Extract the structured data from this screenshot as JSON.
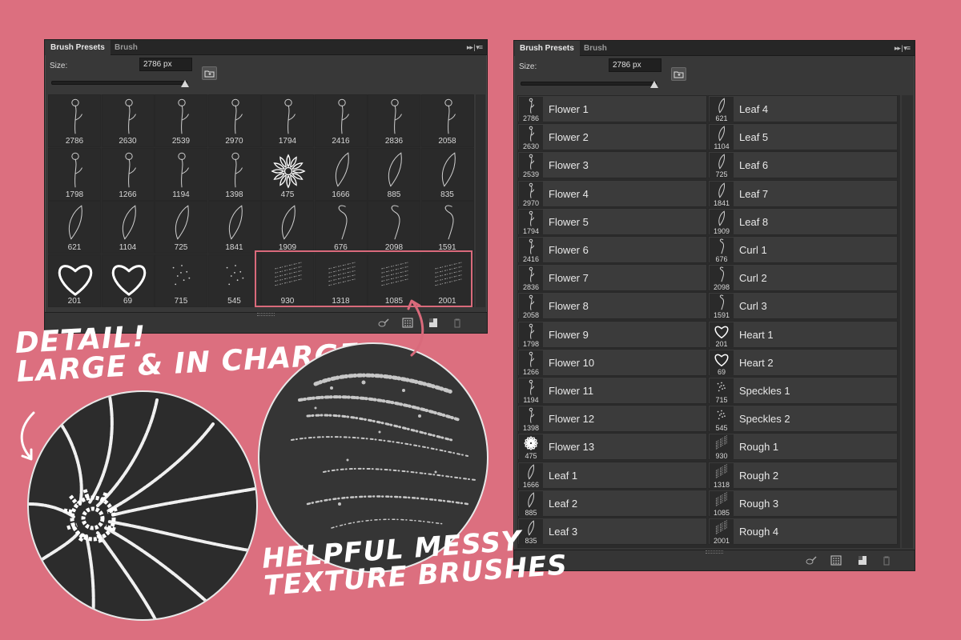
{
  "tabs": {
    "presets": "Brush Presets",
    "brush": "Brush"
  },
  "size": {
    "label": "Size:",
    "value": "2786 px"
  },
  "brushes": [
    {
      "name": "Flower 1",
      "size": "2786"
    },
    {
      "name": "Flower 2",
      "size": "2630"
    },
    {
      "name": "Flower 3",
      "size": "2539"
    },
    {
      "name": "Flower 4",
      "size": "2970"
    },
    {
      "name": "Flower 5",
      "size": "1794"
    },
    {
      "name": "Flower 6",
      "size": "2416"
    },
    {
      "name": "Flower 7",
      "size": "2836"
    },
    {
      "name": "Flower 8",
      "size": "2058"
    },
    {
      "name": "Flower 9",
      "size": "1798"
    },
    {
      "name": "Flower 10",
      "size": "1266"
    },
    {
      "name": "Flower 11",
      "size": "1194"
    },
    {
      "name": "Flower 12",
      "size": "1398"
    },
    {
      "name": "Flower 13",
      "size": "475"
    },
    {
      "name": "Leaf 1",
      "size": "1666"
    },
    {
      "name": "Leaf 2",
      "size": "885"
    },
    {
      "name": "Leaf 3",
      "size": "835"
    },
    {
      "name": "Leaf 4",
      "size": "621"
    },
    {
      "name": "Leaf 5",
      "size": "1104"
    },
    {
      "name": "Leaf 6",
      "size": "725"
    },
    {
      "name": "Leaf 7",
      "size": "1841"
    },
    {
      "name": "Leaf 8",
      "size": "1909"
    },
    {
      "name": "Curl 1",
      "size": "676"
    },
    {
      "name": "Curl 2",
      "size": "2098"
    },
    {
      "name": "Curl 3",
      "size": "1591"
    },
    {
      "name": "Heart 1",
      "size": "201"
    },
    {
      "name": "Heart 2",
      "size": "69"
    },
    {
      "name": "Speckles 1",
      "size": "715"
    },
    {
      "name": "Speckles 2",
      "size": "545"
    },
    {
      "name": "Rough 1",
      "size": "930"
    },
    {
      "name": "Rough 2",
      "size": "1318"
    },
    {
      "name": "Rough 3",
      "size": "1085"
    },
    {
      "name": "Rough 4",
      "size": "2001"
    }
  ],
  "callouts": {
    "detail_line1": "Detail!",
    "detail_line2": "Large & in charge",
    "messy_line1": "Helpful messy",
    "messy_line2": "texture brushes"
  },
  "colors": {
    "background": "#dc6f7f",
    "panel": "#383838",
    "highlight": "#d96a7b"
  },
  "icons": {
    "panel_menu": "double-arrow-menu-icon",
    "new_folder": "folder-plus-icon",
    "toggle_brush_panel": "brush-toggle-icon",
    "grid_view": "grid-view-icon",
    "new_preset": "new-page-icon",
    "delete": "trash-icon"
  }
}
